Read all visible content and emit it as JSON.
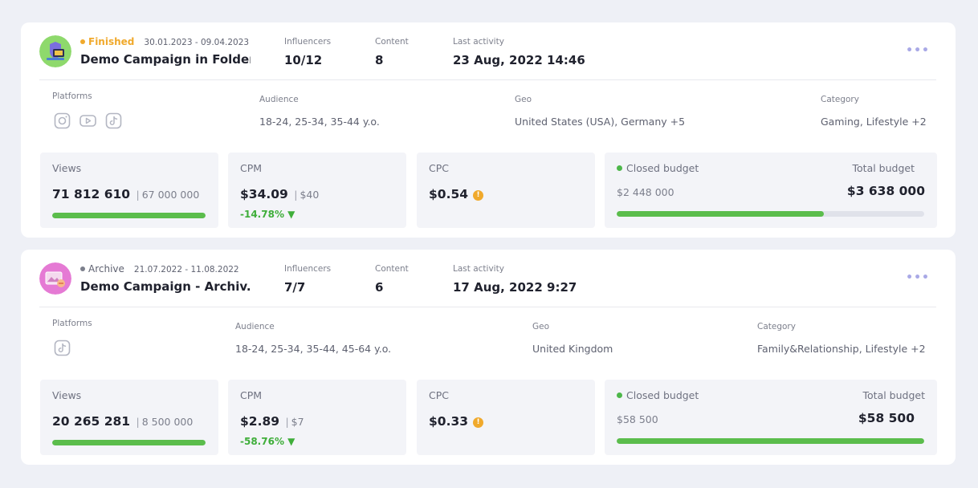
{
  "campaigns": [
    {
      "status": "Finished",
      "status_color": "#f0a92c",
      "dates": "30.01.2023 - 09.04.2023",
      "title": "Demo Campaign in Folder",
      "avatar_color": "#8ed96c",
      "influencers_label": "Influencers",
      "influencers_value": "10/12",
      "content_label": "Content",
      "content_value": "8",
      "last_activity_label": "Last activity",
      "last_activity_value": "23 Aug, 2022 14:46",
      "more_label": "•••",
      "platforms_label": "Platforms",
      "platforms": [
        "instagram-icon",
        "youtube-icon",
        "tiktok-icon"
      ],
      "audience_label": "Audience",
      "audience_value": "18-24, 25-34, 35-44 y.o.",
      "geo_label": "Geo",
      "geo_value": "United States (USA), Germany +5",
      "category_label": "Category",
      "category_value": "Gaming, Lifestyle +2",
      "views_label": "Views",
      "views_value": "71 812 610",
      "views_target": "67 000 000",
      "views_progress": 1.0,
      "cpm_label": "CPM",
      "cpm_value": "$34.09",
      "cpm_target": "$40",
      "cpm_delta": "-14.78% ▼",
      "cpc_label": "CPC",
      "cpc_value": "$0.54",
      "warn_symbol": "!",
      "closed_budget_label": "Closed budget",
      "closed_budget_value": "$2 448 000",
      "total_budget_label": "Total budget",
      "total_budget_value": "$3 638 000",
      "budget_progress": 0.673
    },
    {
      "status": "Archive",
      "status_color": "#7c7f8c",
      "dates": "21.07.2022 - 11.08.2022",
      "title": "Demo Campaign - Archiv...",
      "avatar_color": "#e57ad4",
      "influencers_label": "Influencers",
      "influencers_value": "7/7",
      "content_label": "Content",
      "content_value": "6",
      "last_activity_label": "Last activity",
      "last_activity_value": "17 Aug, 2022 9:27",
      "more_label": "•••",
      "platforms_label": "Platforms",
      "platforms": [
        "tiktok-icon"
      ],
      "audience_label": "Audience",
      "audience_value": "18-24, 25-34, 35-44, 45-64 y.o.",
      "geo_label": "Geo",
      "geo_value": "United Kingdom",
      "category_label": "Category",
      "category_value": "Family&Relationship, Lifestyle +2",
      "views_label": "Views",
      "views_value": "20 265 281",
      "views_target": "8 500 000",
      "views_progress": 1.0,
      "cpm_label": "CPM",
      "cpm_value": "$2.89",
      "cpm_target": "$7",
      "cpm_delta": "-58.76% ▼",
      "cpc_label": "CPC",
      "cpc_value": "$0.33",
      "warn_symbol": "!",
      "closed_budget_label": "Closed budget",
      "closed_budget_value": "$58 500",
      "total_budget_label": "Total budget",
      "total_budget_value": "$58 500",
      "budget_progress": 1.0
    }
  ]
}
